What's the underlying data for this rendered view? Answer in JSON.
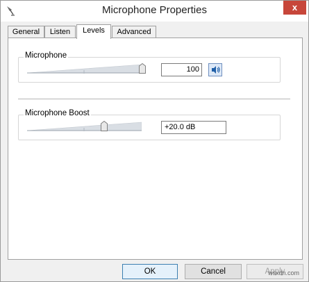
{
  "window": {
    "title": "Microphone Properties",
    "close_glyph": "x"
  },
  "tabs": [
    {
      "label": "General",
      "active": false
    },
    {
      "label": "Listen",
      "active": false
    },
    {
      "label": "Levels",
      "active": true
    },
    {
      "label": "Advanced",
      "active": false
    }
  ],
  "microphone": {
    "label": "Microphone",
    "value": "100",
    "level_fraction": 1.0
  },
  "boost": {
    "label": "Microphone Boost",
    "value": "+20.0 dB",
    "level_fraction": 0.667
  },
  "buttons": {
    "ok": "OK",
    "cancel": "Cancel",
    "apply": "Apply"
  },
  "watermark": "wsxdn.com",
  "colors": {
    "close": "#c7463a",
    "default_button_border": "#3c7fb1",
    "slider_fill": "#d9dee4"
  },
  "icons": {
    "mute_toggle": "speaker-icon",
    "app": "microphone-icon"
  }
}
